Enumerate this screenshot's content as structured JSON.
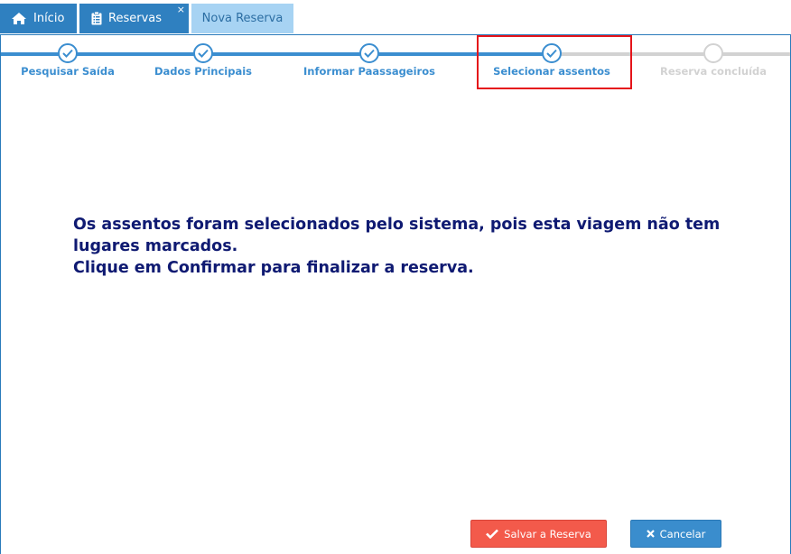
{
  "tabs": [
    {
      "label": "Início",
      "icon": "home-icon"
    },
    {
      "label": "Reservas",
      "icon": "clipboard-icon",
      "close": "×"
    },
    {
      "label": "Nova Reserva"
    }
  ],
  "wizard": {
    "steps": [
      {
        "label": "Pesquisar Saída",
        "state": "done"
      },
      {
        "label": "Dados Principais",
        "state": "done"
      },
      {
        "label": "Informar Paassageiros",
        "state": "done"
      },
      {
        "label": "Selecionar assentos",
        "state": "current"
      },
      {
        "label": "Reserva concluída",
        "state": "pending"
      }
    ]
  },
  "message": {
    "line1": "Os assentos foram selecionados pelo sistema, pois esta viagem não tem lugares marcados.",
    "line2": "Clique em Confirmar para finalizar a reserva."
  },
  "buttons": {
    "save": "Salvar a Reserva",
    "cancel": "Cancelar"
  },
  "colors": {
    "primary": "#2f80c0",
    "active_tab": "#a7d3f3",
    "step_done": "#3b8ed0",
    "step_pending": "#d2d2d2",
    "message_text": "#0f1a72",
    "save_button": "#f35a4b",
    "cancel_button": "#3a8dcd",
    "highlight": "#e5141a"
  }
}
